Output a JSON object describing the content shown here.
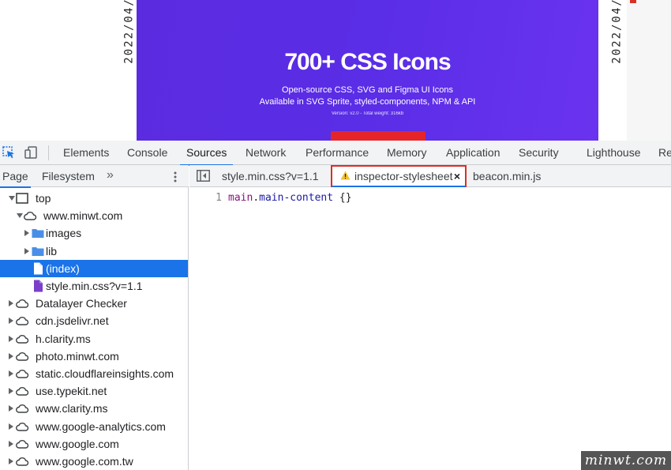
{
  "webpage": {
    "date_left": "2022/04/",
    "date_right": "2022/04/",
    "banner": {
      "title": "700+ CSS Icons",
      "subtitle_line1": "Open-source CSS, SVG and Figma UI Icons",
      "subtitle_line2": "Available in SVG Sprite, styled-components, NPM & API",
      "version": "Version: v2.0 - Total weight: 316kb"
    }
  },
  "devtools": {
    "main_tabs": [
      {
        "label": "Elements"
      },
      {
        "label": "Console"
      },
      {
        "label": "Sources"
      },
      {
        "label": "Network"
      },
      {
        "label": "Performance"
      },
      {
        "label": "Memory"
      },
      {
        "label": "Application"
      },
      {
        "label": "Security"
      },
      {
        "label": "Lighthouse"
      },
      {
        "label": "Re"
      }
    ],
    "navigator": {
      "tabs": [
        {
          "label": "Page"
        },
        {
          "label": "Filesystem"
        }
      ],
      "more": "»",
      "tree": [
        {
          "label": "top",
          "icon": "frame-icon",
          "arrow": "down",
          "level": 0
        },
        {
          "label": "www.minwt.com",
          "icon": "cloud-icon",
          "arrow": "down",
          "level": 1
        },
        {
          "label": "images",
          "icon": "folder-icon",
          "arrow": "right",
          "level": 2
        },
        {
          "label": "lib",
          "icon": "folder-icon",
          "arrow": "right",
          "level": 2
        },
        {
          "label": "(index)",
          "icon": "document-icon",
          "arrow": "",
          "level": 2,
          "selected": true
        },
        {
          "label": "style.min.css?v=1.1",
          "icon": "stylesheet-icon",
          "arrow": "",
          "level": 2
        },
        {
          "label": "Datalayer Checker",
          "icon": "cloud-icon",
          "arrow": "right",
          "level": 0
        },
        {
          "label": "cdn.jsdelivr.net",
          "icon": "cloud-icon",
          "arrow": "right",
          "level": 0
        },
        {
          "label": "h.clarity.ms",
          "icon": "cloud-icon",
          "arrow": "right",
          "level": 0
        },
        {
          "label": "photo.minwt.com",
          "icon": "cloud-icon",
          "arrow": "right",
          "level": 0
        },
        {
          "label": "static.cloudflareinsights.com",
          "icon": "cloud-icon",
          "arrow": "right",
          "level": 0
        },
        {
          "label": "use.typekit.net",
          "icon": "cloud-icon",
          "arrow": "right",
          "level": 0
        },
        {
          "label": "www.clarity.ms",
          "icon": "cloud-icon",
          "arrow": "right",
          "level": 0
        },
        {
          "label": "www.google-analytics.com",
          "icon": "cloud-icon",
          "arrow": "right",
          "level": 0
        },
        {
          "label": "www.google.com",
          "icon": "cloud-icon",
          "arrow": "right",
          "level": 0
        },
        {
          "label": "www.google.com.tw",
          "icon": "cloud-icon",
          "arrow": "right",
          "level": 0
        }
      ]
    },
    "editor": {
      "tabs": [
        {
          "label": "style.min.css?v=1.1"
        },
        {
          "label": "inspector-stylesheet",
          "active": true,
          "close": "×"
        },
        {
          "label": "beacon.min.js"
        }
      ],
      "line_number": "1",
      "code": {
        "tag": "main",
        "dot": ".",
        "cls": "main-content",
        "rest": " {}"
      }
    }
  },
  "watermark": "minwt.com",
  "colors": {
    "accent": "#1a73e8",
    "highlight": "#d93025",
    "banner": "#5a2de6"
  }
}
